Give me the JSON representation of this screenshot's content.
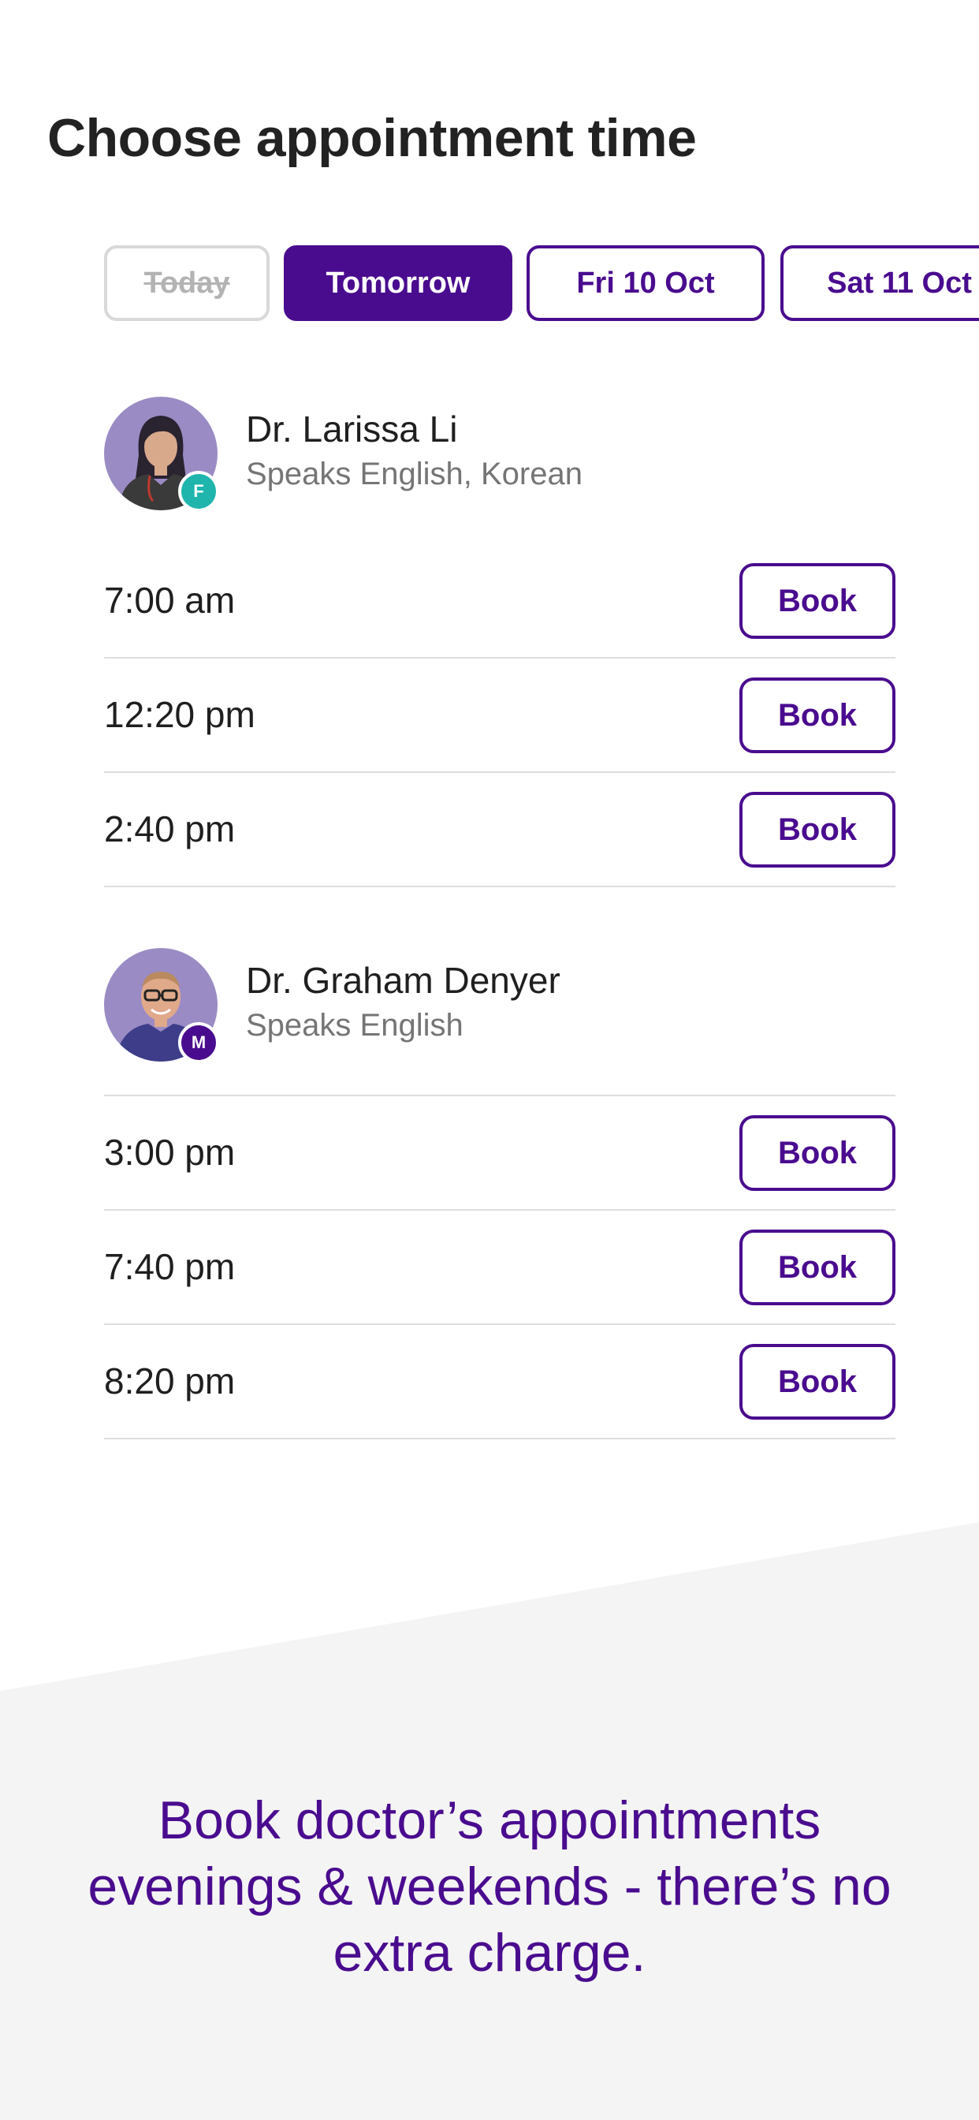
{
  "title": "Choose appointment time",
  "date_tabs": [
    {
      "label": "Today",
      "state": "disabled"
    },
    {
      "label": "Tomorrow",
      "state": "selected"
    },
    {
      "label": "Fri 10 Oct",
      "state": "default"
    },
    {
      "label": "Sat 11 Oct",
      "state": "default"
    }
  ],
  "doctors": [
    {
      "name": "Dr. Larissa Li",
      "languages": "Speaks English, Korean",
      "badge": "F",
      "badge_color": "#1fb5ad",
      "slots": [
        {
          "time": "7:00 am",
          "action": "Book"
        },
        {
          "time": "12:20 pm",
          "action": "Book"
        },
        {
          "time": "2:40 pm",
          "action": "Book"
        }
      ]
    },
    {
      "name": "Dr. Graham Denyer",
      "languages": "Speaks English",
      "badge": "M",
      "badge_color": "#4a0c8f",
      "slots": [
        {
          "time": "3:00 pm",
          "action": "Book"
        },
        {
          "time": "7:40 pm",
          "action": "Book"
        },
        {
          "time": "8:20 pm",
          "action": "Book"
        }
      ]
    }
  ],
  "promo": {
    "text": "Book doctor’s appointments evenings & weekends - there’s no extra charge."
  },
  "colors": {
    "accent": "#4a0c8f",
    "promo_background": "#f4f4f4",
    "divider": "#dedede"
  }
}
